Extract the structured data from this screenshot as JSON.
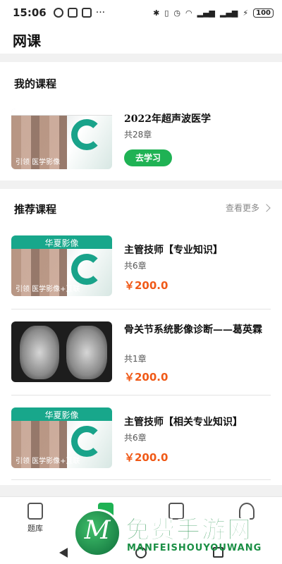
{
  "status_bar": {
    "time": "15:06",
    "battery": "100"
  },
  "app": {
    "title": "网课"
  },
  "my_courses": {
    "title": "我的课程",
    "course": {
      "name": "2022年超声波医学",
      "count": "共28章",
      "button_label": "去学习",
      "banner_text": "引领 医学影像"
    }
  },
  "recommended": {
    "title": "推荐课程",
    "see_more": "查看更多",
    "items": [
      {
        "name": "主管技师【专业知识】",
        "count": "共6章",
        "price": "￥200.0",
        "brand": "华夏影像",
        "banner_text": "引领 医学影像+互联"
      },
      {
        "name": "骨关节系统影像诊断——葛英霖",
        "count": "共1章",
        "price": "￥200.0"
      },
      {
        "name": "主管技师【相关专业知识】",
        "count": "共6章",
        "price": "￥200.0",
        "brand": "华夏影像",
        "banner_text": "引领 医学影像+互联"
      }
    ]
  },
  "bottom_nav": {
    "items": [
      {
        "label": "题库",
        "icon": "pen-paper-icon"
      },
      {
        "label": "",
        "icon": "play-icon"
      },
      {
        "label": "",
        "icon": "book-icon"
      },
      {
        "label": "",
        "icon": "doctor-icon"
      }
    ]
  },
  "watermark": {
    "title": "免费手游网",
    "subtitle": "MANFEISHOUYOUWANG",
    "logo_letter": "M"
  },
  "colors": {
    "accent_green": "#1fb254",
    "price_orange": "#f05a18",
    "brand_teal": "#18a78b"
  }
}
